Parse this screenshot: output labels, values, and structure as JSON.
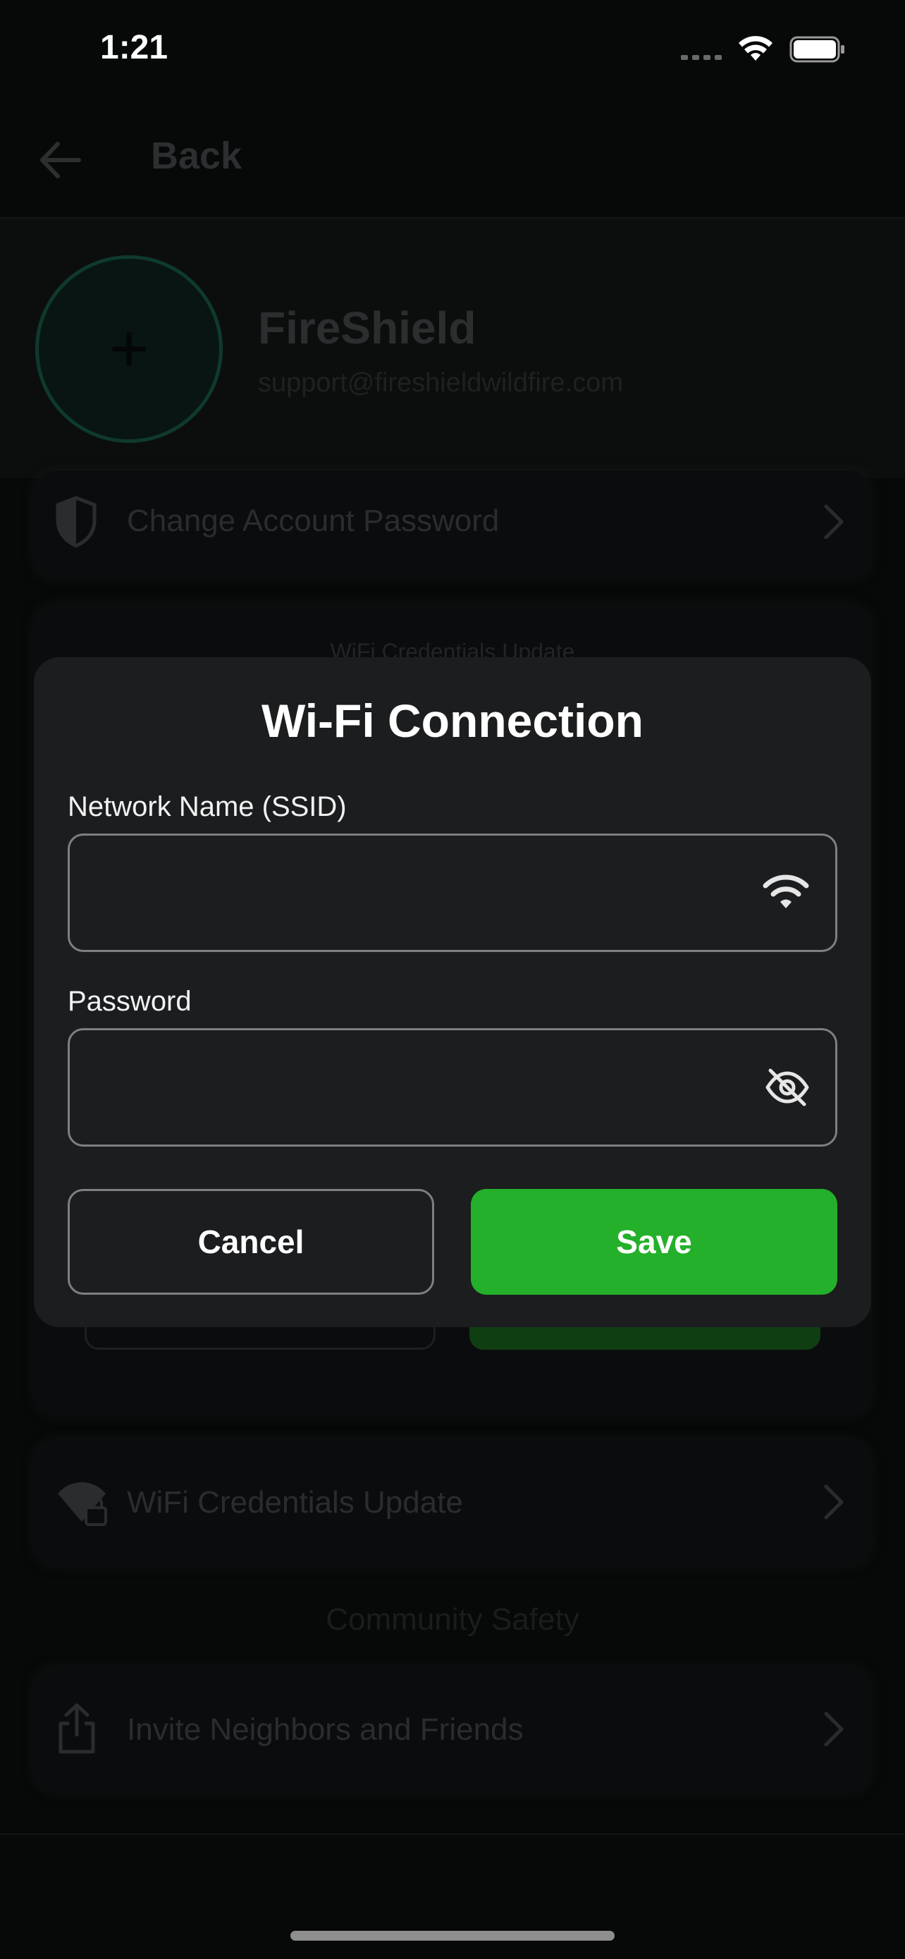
{
  "status_bar": {
    "time": "1:21"
  },
  "header": {
    "back_label": "Back"
  },
  "profile": {
    "name": "FireShield",
    "email": "support@fireshieldwildfire.com"
  },
  "account_rows": {
    "change_password": "Change Account Password",
    "wifi_card_title": "WiFi Credentials Update",
    "wifi_update": "WiFi Credentials Update"
  },
  "community": {
    "section_title": "Community Safety",
    "invite": "Invite Neighbors and Friends"
  },
  "modal": {
    "title": "Wi-Fi Connection",
    "ssid_label": "Network Name (SSID)",
    "ssid_value": "",
    "password_label": "Password",
    "password_value": "",
    "cancel_label": "Cancel",
    "save_label": "Save"
  },
  "colors": {
    "accent_green": "#24b02a",
    "modal_bg": "#1b1d1f",
    "background": "#070808"
  }
}
